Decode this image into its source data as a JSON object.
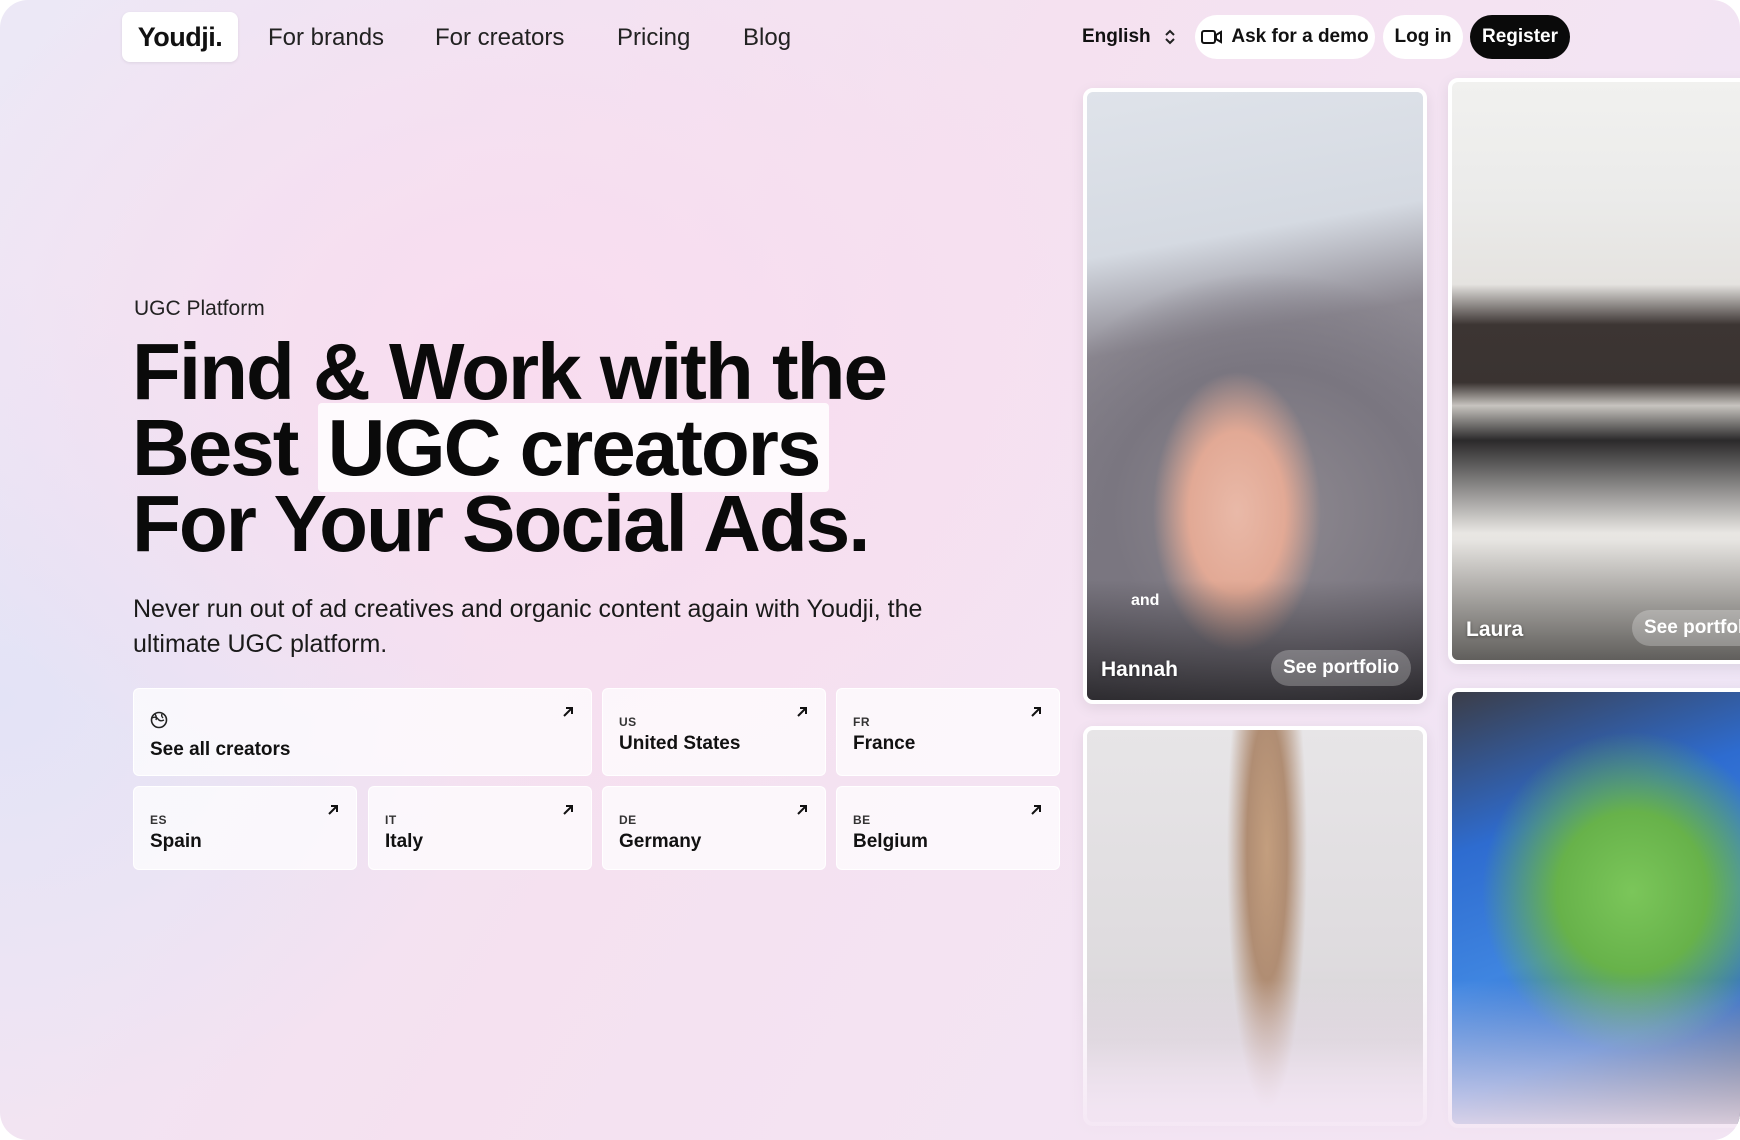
{
  "nav": {
    "logo": "Youdji.",
    "links": [
      "For brands",
      "For creators",
      "Pricing",
      "Blog"
    ],
    "language": "English",
    "demo_label": "Ask for a demo",
    "login_label": "Log in",
    "register_label": "Register"
  },
  "hero": {
    "eyebrow": "UGC Platform",
    "headline_line1": "Find & Work with the",
    "headline_line2_prefix": "Best",
    "headline_highlight": "UGC creators",
    "headline_line3": "For Your Social Ads.",
    "subtitle": "Never run out of ad creatives and organic content again with Youdji, the ultimate UGC platform."
  },
  "countries": {
    "all_label": "See all creators",
    "items": [
      {
        "code": "US",
        "name": "United States"
      },
      {
        "code": "FR",
        "name": "France"
      },
      {
        "code": "ES",
        "name": "Spain"
      },
      {
        "code": "IT",
        "name": "Italy"
      },
      {
        "code": "DE",
        "name": "Germany"
      },
      {
        "code": "BE",
        "name": "Belgium"
      }
    ]
  },
  "gallery": {
    "tiles": [
      {
        "creator": "Hannah",
        "caption": "and",
        "see_label": "See portfolio"
      },
      {
        "creator": "Laura",
        "see_label": "See portfolio"
      }
    ]
  },
  "colors": {
    "accent": "#0a0a0a",
    "background_pink": "#f5e1f0",
    "background_lavender": "#ece8f6"
  }
}
